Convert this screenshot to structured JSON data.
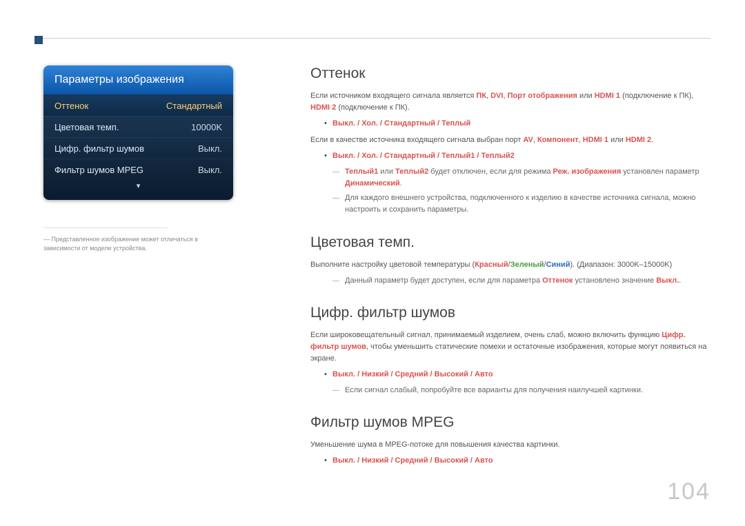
{
  "osd": {
    "title": "Параметры изображения",
    "rows": [
      {
        "label": "Оттенок",
        "value": "Стандартный"
      },
      {
        "label": "Цветовая темп.",
        "value": "10000K"
      },
      {
        "label": "Цифр. фильтр шумов",
        "value": "Выкл."
      },
      {
        "label": "Фильтр шумов MPEG",
        "value": "Выкл."
      }
    ],
    "arrow": "▾"
  },
  "disclaimer": {
    "dash": "―",
    "text": "Представленное изображение может отличаться в зависимости от модели устройства."
  },
  "sections": {
    "hue": {
      "title": "Оттенок",
      "p1a": "Если источником входящего сигнала является ",
      "p1_pc": "ПК",
      "p1_comma1": ", ",
      "p1_dvi": "DVI",
      "p1_comma2": ", ",
      "p1_dp": "Порт отображения",
      "p1_or": " или ",
      "p1_hdmi1": "HDMI 1",
      "p1b": " (подключение к ПК), ",
      "p1_hdmi2": "HDMI 2",
      "p1c": " (подключение к ПК).",
      "bullet1": "Выкл. / Хол. / Стандартный / Теплый",
      "p2a": "Если в качестве источника входящего сигнала выбран порт ",
      "p2_av": "AV",
      "p2_c1": ", ",
      "p2_comp": "Компонент",
      "p2_c2": ", ",
      "p2_h1": "HDMI 1",
      "p2_or": " или ",
      "p2_h2": "HDMI 2",
      "p2b": ".",
      "bullet2": "Выкл. / Хол. / Стандартный / Теплый1 / Теплый2",
      "dash1a": "Теплый1",
      "dash1b": " или ",
      "dash1c": "Теплый2",
      "dash1d": " будет отключен, если для режима ",
      "dash1e": "Реж. изображения",
      "dash1f": " установлен параметр ",
      "dash1g": "Динамический",
      "dash1h": ".",
      "dash2": "Для каждого внешнего устройства, подключенного к изделию в качестве источника сигнала, можно настроить и сохранить параметры."
    },
    "colortemp": {
      "title": "Цветовая темп.",
      "p1a": "Выполните настройку цветовой температуры (",
      "p1_red": "Красный",
      "p1_s1": "/",
      "p1_green": "Зеленый",
      "p1_s2": "/",
      "p1_blue": "Синий",
      "p1b": "). (Диапазон: 3000K–15000K)",
      "dash1a": "Данный параметр будет доступен, если для параметра ",
      "dash1b": "Оттенок",
      "dash1c": " установлено значение ",
      "dash1d": "Выкл.",
      "dash1e": "."
    },
    "noise": {
      "title": "Цифр. фильтр шумов",
      "p1a": "Если широковещательный сигнал, принимаемый изделием, очень слаб, можно включить функцию ",
      "p1b": "Цифр. фильтр шумов",
      "p1c": ", чтобы уменьшить статические помехи и остаточные изображения, которые могут появиться на экране.",
      "bullet1": "Выкл. / Низкий / Средний / Высокий / Авто",
      "dash1": "Если сигнал слабый, попробуйте все варианты для получения наилучшей картинки."
    },
    "mpeg": {
      "title": "Фильтр шумов MPEG",
      "p1": "Уменьшение шума в MPEG-потоке для повышения качества картинки.",
      "bullet1": "Выкл. / Низкий / Средний / Высокий / Авто"
    }
  },
  "page_number": "104"
}
